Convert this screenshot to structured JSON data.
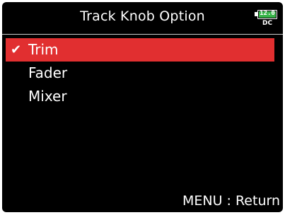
{
  "header": {
    "title": "Track Knob Option",
    "battery": {
      "value": "12.0",
      "source": "DC",
      "color": "#3ab54a",
      "icon": "battery-icon"
    }
  },
  "menu": {
    "items": [
      {
        "label": "Trim",
        "selected": true,
        "check_icon": "checkmark-icon"
      },
      {
        "label": "Fader",
        "selected": false
      },
      {
        "label": "Mixer",
        "selected": false
      }
    ]
  },
  "footer": {
    "hint": "MENU : Return"
  },
  "colors": {
    "background": "#000000",
    "selection": "#e12f30",
    "text": "#ffffff"
  }
}
